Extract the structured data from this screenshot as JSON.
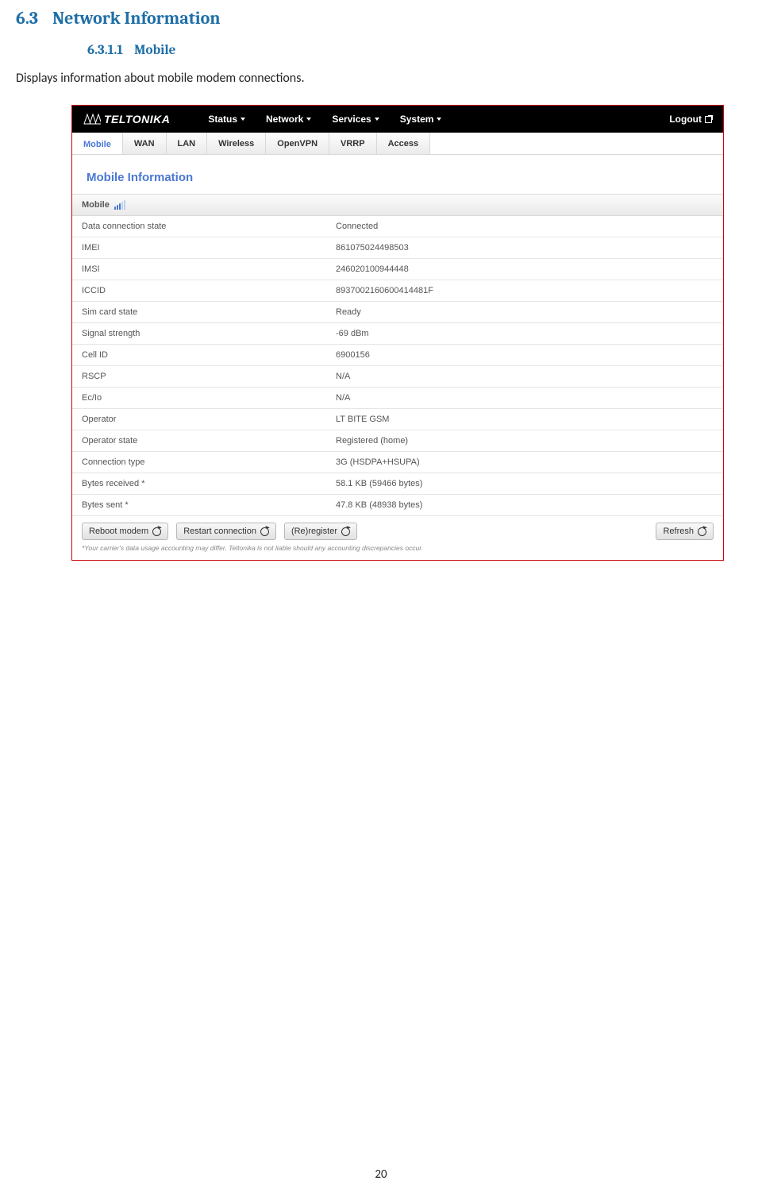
{
  "doc": {
    "section_num": "6.3",
    "section_title": "Network Information",
    "sub_num": "6.3.1.1",
    "sub_title": "Mobile",
    "intro": "Displays information about mobile modem connections.",
    "page_number": "20"
  },
  "ui": {
    "brand": "TELTONIKA",
    "topmenu": {
      "m1": "Status",
      "m2": "Network",
      "m3": "Services",
      "m4": "System"
    },
    "logout": "Logout",
    "tabs": {
      "t1": "Mobile",
      "t2": "WAN",
      "t3": "LAN",
      "t4": "Wireless",
      "t5": "OpenVPN",
      "t6": "VRRP",
      "t7": "Access"
    },
    "page_title": "Mobile Information",
    "panel_header": "Mobile",
    "rows": {
      "r0": {
        "label": "Data connection state",
        "value": "Connected"
      },
      "r1": {
        "label": "IMEI",
        "value": "861075024498503"
      },
      "r2": {
        "label": "IMSI",
        "value": "246020100944448"
      },
      "r3": {
        "label": "ICCID",
        "value": "8937002160600414481F"
      },
      "r4": {
        "label": "Sim card state",
        "value": "Ready"
      },
      "r5": {
        "label": "Signal strength",
        "value": "-69 dBm"
      },
      "r6": {
        "label": "Cell ID",
        "value": "6900156"
      },
      "r7": {
        "label": "RSCP",
        "value": "N/A"
      },
      "r8": {
        "label": "Ec/Io",
        "value": "N/A"
      },
      "r9": {
        "label": "Operator",
        "value": "LT BITE GSM"
      },
      "r10": {
        "label": "Operator state",
        "value": "Registered (home)"
      },
      "r11": {
        "label": "Connection type",
        "value": "3G (HSDPA+HSUPA)"
      },
      "r12": {
        "label": "Bytes received *",
        "value": "58.1 KB (59466 bytes)"
      },
      "r13": {
        "label": "Bytes sent *",
        "value": "47.8 KB (48938 bytes)"
      }
    },
    "buttons": {
      "b1": "Reboot modem",
      "b2": "Restart connection",
      "b3": "(Re)register",
      "b4": "Refresh"
    },
    "footnote": "*Your carrier's data usage accounting may differ. Teltonika is not liable should any accounting discrepancies occur."
  }
}
